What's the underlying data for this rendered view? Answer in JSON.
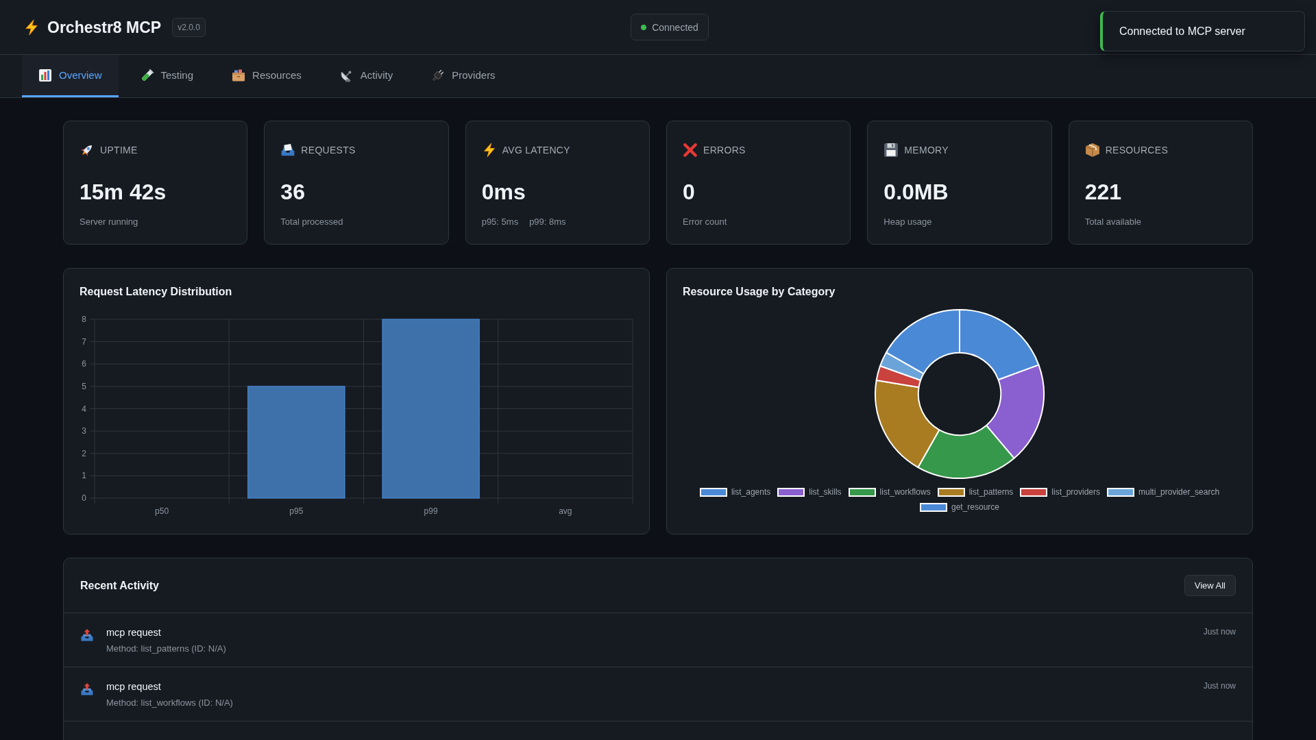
{
  "header": {
    "title": "Orchestr8 MCP",
    "version": "v2.0.0",
    "connection": {
      "label": "Connected",
      "connected": true
    }
  },
  "toast": {
    "message": "Connected to MCP server"
  },
  "tabs": [
    {
      "label": "Overview",
      "selected": true
    },
    {
      "label": "Testing",
      "selected": false
    },
    {
      "label": "Resources",
      "selected": false
    },
    {
      "label": "Activity",
      "selected": false
    },
    {
      "label": "Providers",
      "selected": false
    }
  ],
  "stats": [
    {
      "label": "UPTIME",
      "value": "15m 42s",
      "details": [
        "Server running"
      ]
    },
    {
      "label": "REQUESTS",
      "value": "36",
      "details": [
        "Total processed"
      ]
    },
    {
      "label": "AVG LATENCY",
      "value": "0ms",
      "details": [
        "p95: 5ms",
        "p99: 8ms"
      ]
    },
    {
      "label": "ERRORS",
      "value": "0",
      "details": [
        "Error count"
      ]
    },
    {
      "label": "MEMORY",
      "value": "0.0MB",
      "details": [
        "Heap usage"
      ]
    },
    {
      "label": "RESOURCES",
      "value": "221",
      "details": [
        "Total available"
      ]
    }
  ],
  "latency_panel": {
    "chart_data": [
      {
        "type": "bar",
        "title": "Request Latency Distribution",
        "categories": [
          "p50",
          "p95",
          "p99",
          "avg"
        ],
        "values": [
          0,
          5,
          8,
          0
        ],
        "color": "#3e71aa",
        "ylim": [
          0,
          8
        ],
        "yticks": [
          0,
          1,
          2,
          3,
          4,
          5,
          6,
          7,
          8
        ],
        "grid": true
      }
    ]
  },
  "resource_panel": {
    "chart_data": [
      {
        "type": "donut",
        "title": "Resource Usage by Category",
        "categories": [
          "list_agents",
          "list_skills",
          "list_workflows",
          "list_patterns",
          "list_providers",
          "multi_provider_search",
          "get_resource"
        ],
        "values": [
          19.4,
          19.4,
          19.4,
          19.4,
          2.8,
          2.8,
          16.8
        ],
        "colors": [
          "#4a89d6",
          "#8a5fcf",
          "#36984a",
          "#a97c22",
          "#c9423d",
          "#6aa4d9",
          "#4a89d6"
        ],
        "legend": "bottom"
      }
    ]
  },
  "activity": {
    "title": "Recent Activity",
    "button": "View All",
    "items": [
      {
        "title": "mcp request",
        "detail": "Method: list_patterns (ID: N/A)",
        "time": "Just now"
      },
      {
        "title": "mcp request",
        "detail": "Method: list_workflows (ID: N/A)",
        "time": "Just now"
      }
    ]
  }
}
